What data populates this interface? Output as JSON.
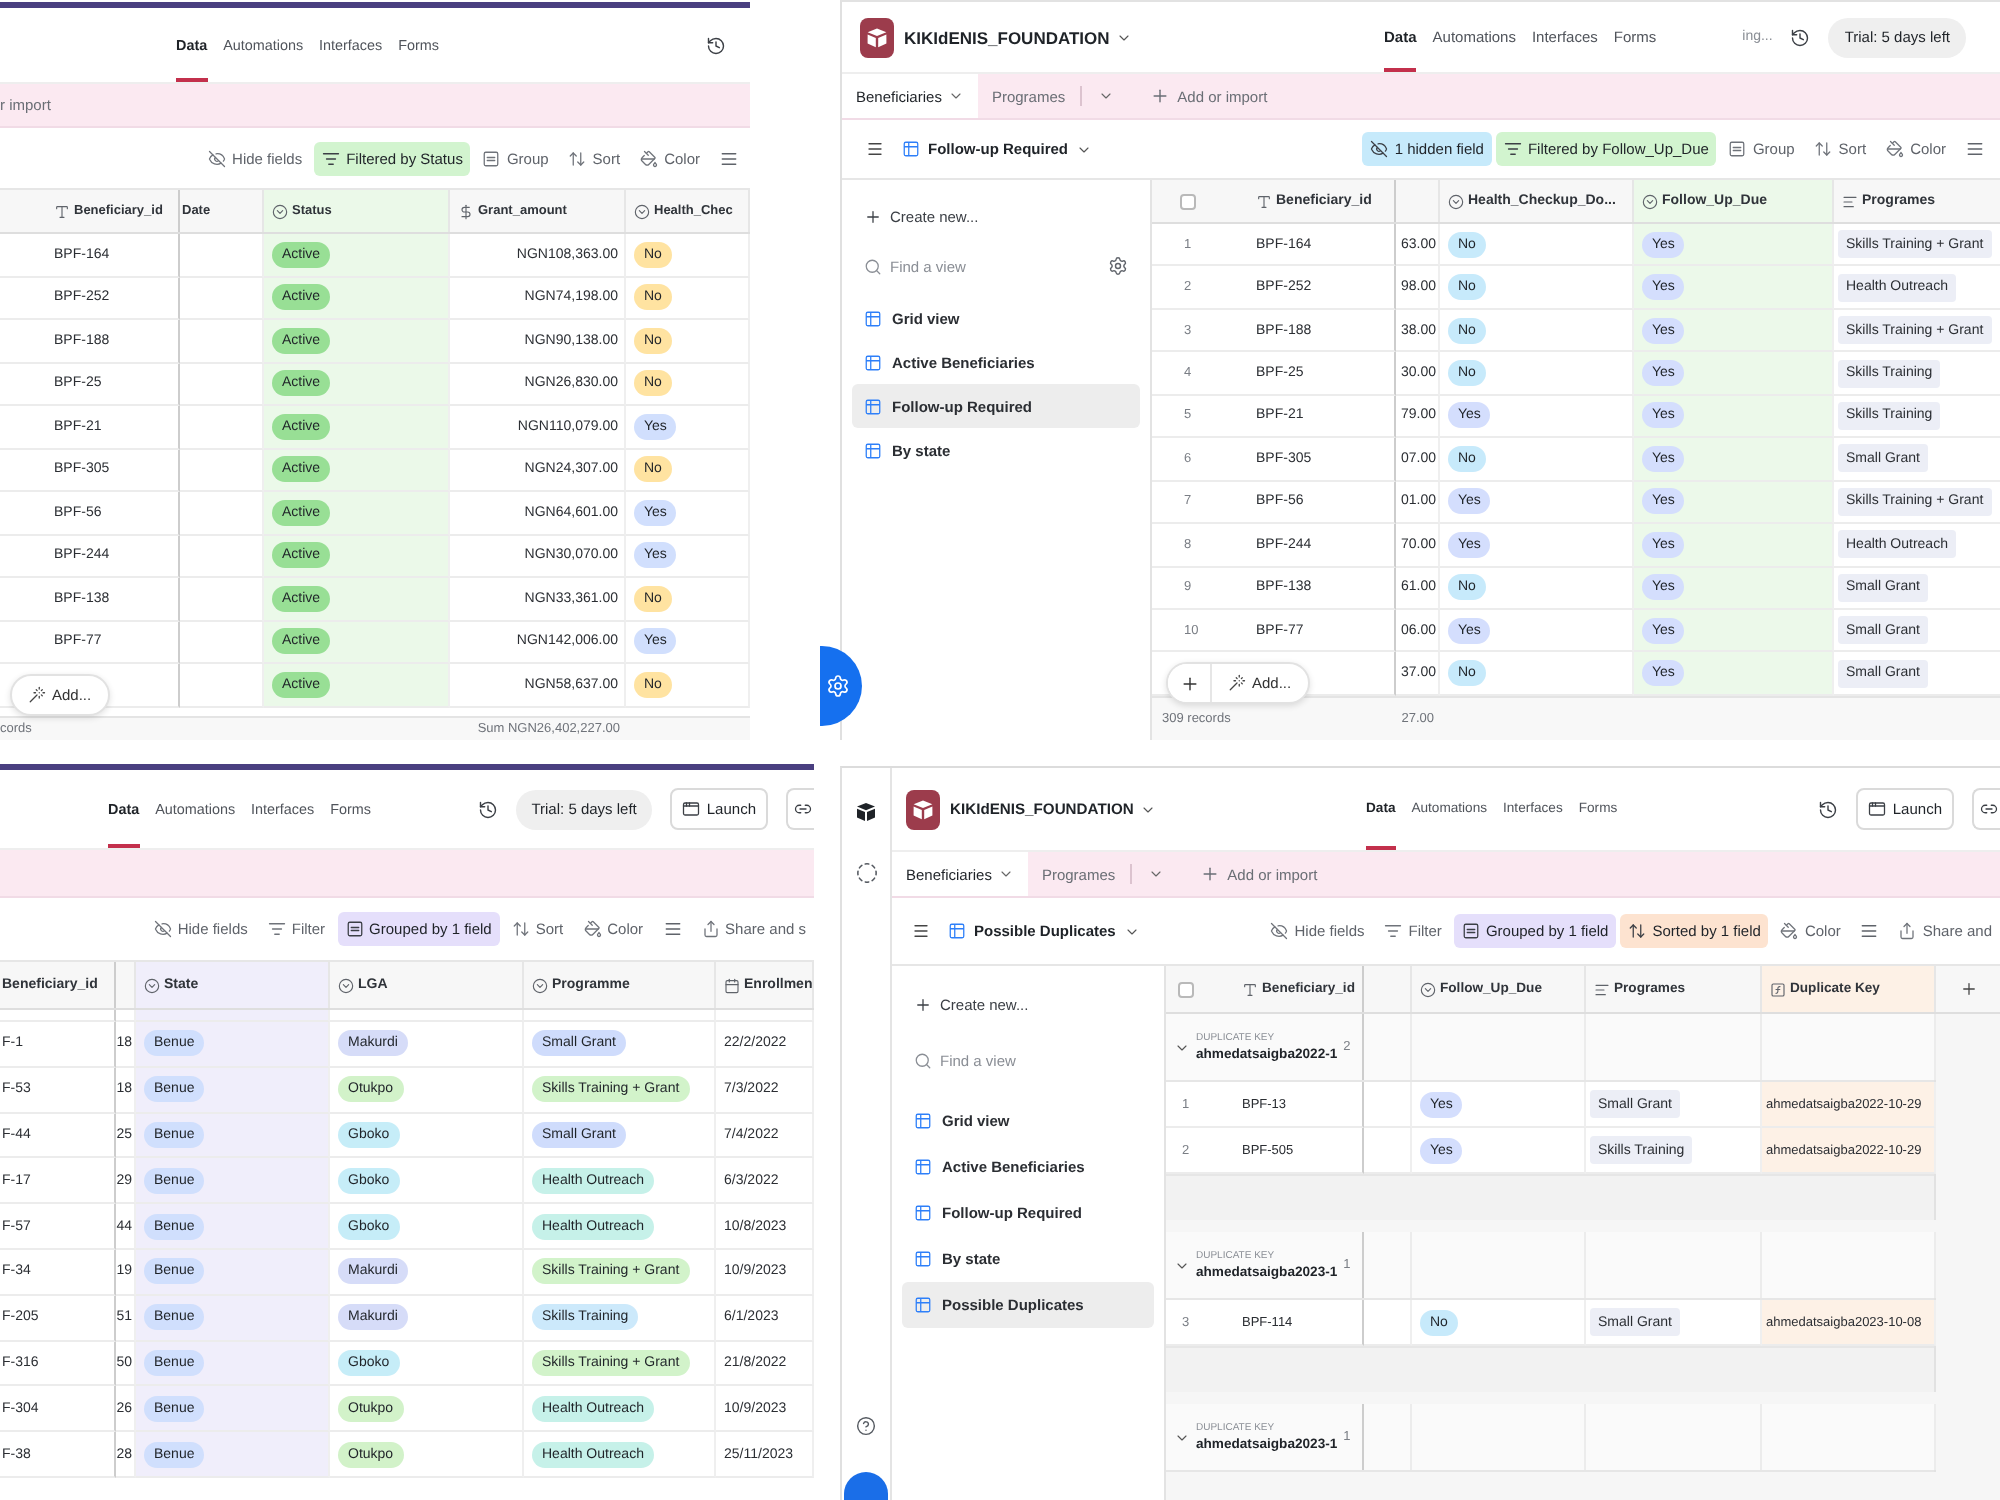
{
  "panels": [
    {
      "header": {
        "nav": [
          {
            "label": "Data",
            "selected": true
          },
          {
            "label": "Automations",
            "selected": false
          },
          {
            "label": "Interfaces",
            "selected": false
          },
          {
            "label": "Forms",
            "selected": false
          }
        ],
        "actions": [
          {
            "kind": "history"
          }
        ]
      },
      "table_tabs": [
        {
          "kind": "text",
          "label": "r import"
        }
      ],
      "toolbar": [
        {
          "kind": "hide",
          "label": "Hide fields"
        },
        {
          "kind": "filter",
          "label": "Filtered by Status",
          "color": "#d2f4cf"
        },
        {
          "kind": "group",
          "label": "Group"
        },
        {
          "kind": "sort",
          "label": "Sort"
        },
        {
          "kind": "color",
          "label": "Color"
        },
        {
          "kind": "row_height"
        }
      ],
      "grid": {
        "columns": [
          {
            "label": "Beneficiary_id",
            "kind": "text"
          },
          {
            "label": "Date",
            "kind": "partial"
          },
          {
            "label": "Status",
            "kind": "pill",
            "color": "#ebf9e9"
          },
          {
            "label": "Grant_amount",
            "kind": "amount"
          },
          {
            "label": "Health_Chec",
            "kind": "pill"
          }
        ],
        "rows": [
          {
            "cells": [
              "BPF-164",
              null,
              {
                "text": "Active",
                "color": "#98df95"
              },
              "NGN108,363.00",
              {
                "text": "No",
                "color": "#ffe3a1"
              }
            ]
          },
          {
            "cells": [
              "BPF-252",
              null,
              {
                "text": "Active",
                "color": "#98df95"
              },
              "NGN74,198.00",
              {
                "text": "No",
                "color": "#ffe3a1"
              }
            ]
          },
          {
            "cells": [
              "BPF-188",
              null,
              {
                "text": "Active",
                "color": "#98df95"
              },
              "NGN90,138.00",
              {
                "text": "No",
                "color": "#ffe3a1"
              }
            ]
          },
          {
            "cells": [
              "BPF-25",
              null,
              {
                "text": "Active",
                "color": "#98df95"
              },
              "NGN26,830.00",
              {
                "text": "No",
                "color": "#ffe3a1"
              }
            ]
          },
          {
            "cells": [
              "BPF-21",
              null,
              {
                "text": "Active",
                "color": "#98df95"
              },
              "NGN110,079.00",
              {
                "text": "Yes",
                "color": "#d1dffd"
              }
            ]
          },
          {
            "cells": [
              "BPF-305",
              null,
              {
                "text": "Active",
                "color": "#98df95"
              },
              "NGN24,307.00",
              {
                "text": "No",
                "color": "#ffe3a1"
              }
            ]
          },
          {
            "cells": [
              "BPF-56",
              null,
              {
                "text": "Active",
                "color": "#98df95"
              },
              "NGN64,601.00",
              {
                "text": "Yes",
                "color": "#d1dffd"
              }
            ]
          },
          {
            "cells": [
              "BPF-244",
              null,
              {
                "text": "Active",
                "color": "#98df95"
              },
              "NGN30,070.00",
              {
                "text": "Yes",
                "color": "#d1dffd"
              }
            ]
          },
          {
            "cells": [
              "BPF-138",
              null,
              {
                "text": "Active",
                "color": "#98df95"
              },
              "NGN33,361.00",
              {
                "text": "No",
                "color": "#ffe3a1"
              }
            ]
          },
          {
            "cells": [
              "BPF-77",
              null,
              {
                "text": "Active",
                "color": "#98df95"
              },
              "NGN142,006.00",
              {
                "text": "Yes",
                "color": "#d1dffd"
              }
            ]
          },
          {
            "cells": [
              null,
              null,
              {
                "text": "Active",
                "color": "#98df95"
              },
              "NGN58,637.00",
              {
                "text": "No",
                "color": "#ffe3a1"
              }
            ]
          }
        ],
        "footer": {
          "records": "cords",
          "summary": "Sum NGN26,402,227.00"
        },
        "add_bar": {
          "label": "Add..."
        }
      }
    },
    {
      "base": {
        "name": "KIKIdENIS_FOUNDATION"
      },
      "header": {
        "nav": [
          {
            "label": "Data",
            "selected": true
          },
          {
            "label": "Automations",
            "selected": false
          },
          {
            "label": "Interfaces",
            "selected": false
          },
          {
            "label": "Forms",
            "selected": false
          }
        ],
        "actions": [
          {
            "kind": "status",
            "label": "ing..."
          },
          {
            "kind": "history"
          },
          {
            "kind": "trial",
            "label": "Trial: 5 days left"
          }
        ]
      },
      "table_tabs": [
        {
          "kind": "table",
          "label": "Beneficiaries",
          "selected": true
        },
        {
          "kind": "table",
          "label": "Programes",
          "selected": false
        },
        {
          "kind": "menu"
        },
        {
          "kind": "add",
          "label": "Add or import"
        }
      ],
      "view": {
        "name": "Follow-up Required"
      },
      "toolbar": [
        {
          "kind": "hide",
          "label": "1 hidden field",
          "color": "#c6eafb"
        },
        {
          "kind": "filter",
          "label": "Filtered by Follow_Up_Due",
          "color": "#d2f4cf"
        },
        {
          "kind": "group",
          "label": "Group"
        },
        {
          "kind": "sort",
          "label": "Sort"
        },
        {
          "kind": "color",
          "label": "Color"
        },
        {
          "kind": "row_height"
        }
      ],
      "sidebar": {
        "create": "Create new...",
        "search_placeholder": "Find a view",
        "settings": true,
        "views": [
          {
            "name": "Grid view",
            "selected": false
          },
          {
            "name": "Active Beneficiaries",
            "selected": false
          },
          {
            "name": "Follow-up Required",
            "selected": true
          },
          {
            "name": "By state",
            "selected": false
          }
        ]
      },
      "grid": {
        "select_all": {
          "checked": false
        },
        "columns": [
          {
            "label": "Beneficiary_id",
            "kind": "text"
          },
          {
            "kind": "partial"
          },
          {
            "label": "Health_Checkup_Do...",
            "kind": "pill"
          },
          {
            "label": "Follow_Up_Due",
            "kind": "pill",
            "color": "#ecf9ea"
          },
          {
            "label": "Programes",
            "kind": "tag"
          }
        ],
        "rows": [
          {
            "number": "1",
            "cells": [
              "BPF-164",
              "63.00",
              {
                "text": "No",
                "color": "#c7eafb"
              },
              {
                "text": "Yes",
                "color": "#d4defd"
              },
              "Skills Training + Grant"
            ]
          },
          {
            "number": "2",
            "cells": [
              "BPF-252",
              "98.00",
              {
                "text": "No",
                "color": "#c7eafb"
              },
              {
                "text": "Yes",
                "color": "#d4defd"
              },
              "Health Outreach"
            ]
          },
          {
            "number": "3",
            "cells": [
              "BPF-188",
              "38.00",
              {
                "text": "No",
                "color": "#c7eafb"
              },
              {
                "text": "Yes",
                "color": "#d4defd"
              },
              "Skills Training + Grant"
            ]
          },
          {
            "number": "4",
            "cells": [
              "BPF-25",
              "30.00",
              {
                "text": "No",
                "color": "#c7eafb"
              },
              {
                "text": "Yes",
                "color": "#d4defd"
              },
              "Skills Training"
            ]
          },
          {
            "number": "5",
            "cells": [
              "BPF-21",
              "79.00",
              {
                "text": "Yes",
                "color": "#d4defd"
              },
              {
                "text": "Yes",
                "color": "#d4defd"
              },
              "Skills Training"
            ]
          },
          {
            "number": "6",
            "cells": [
              "BPF-305",
              "07.00",
              {
                "text": "No",
                "color": "#c7eafb"
              },
              {
                "text": "Yes",
                "color": "#d4defd"
              },
              "Small Grant"
            ]
          },
          {
            "number": "7",
            "cells": [
              "BPF-56",
              "01.00",
              {
                "text": "Yes",
                "color": "#d4defd"
              },
              {
                "text": "Yes",
                "color": "#d4defd"
              },
              "Skills Training + Grant"
            ]
          },
          {
            "number": "8",
            "cells": [
              "BPF-244",
              "70.00",
              {
                "text": "Yes",
                "color": "#d4defd"
              },
              {
                "text": "Yes",
                "color": "#d4defd"
              },
              "Health Outreach"
            ]
          },
          {
            "number": "9",
            "cells": [
              "BPF-138",
              "61.00",
              {
                "text": "No",
                "color": "#c7eafb"
              },
              {
                "text": "Yes",
                "color": "#d4defd"
              },
              "Small Grant"
            ]
          },
          {
            "number": "10",
            "cells": [
              "BPF-77",
              "06.00",
              {
                "text": "Yes",
                "color": "#d4defd"
              },
              {
                "text": "Yes",
                "color": "#d4defd"
              },
              "Small Grant"
            ]
          },
          {
            "cells": [
              null,
              "37.00",
              {
                "text": "No",
                "color": "#c7eafb"
              },
              {
                "text": "Yes",
                "color": "#d4defd"
              },
              "Small Grant"
            ]
          }
        ],
        "footer": {
          "records": "309 records",
          "summary": "27.00"
        },
        "add_bar": {
          "plus": true,
          "label": "Add..."
        }
      }
    },
    {
      "header": {
        "nav": [
          {
            "label": "Data",
            "selected": true
          },
          {
            "label": "Automations",
            "selected": false
          },
          {
            "label": "Interfaces",
            "selected": false
          },
          {
            "label": "Forms",
            "selected": false
          }
        ],
        "actions": [
          {
            "kind": "history"
          },
          {
            "kind": "trial",
            "label": "Trial: 5 days left"
          },
          {
            "kind": "launch",
            "label": "Launch"
          },
          {
            "kind": "link"
          }
        ]
      },
      "toolbar": [
        {
          "kind": "hide",
          "label": "Hide fields"
        },
        {
          "kind": "filter",
          "label": "Filter"
        },
        {
          "kind": "group",
          "label": "Grouped by 1 field",
          "color": "#e5dffb"
        },
        {
          "kind": "sort",
          "label": "Sort"
        },
        {
          "kind": "color",
          "label": "Color"
        },
        {
          "kind": "row_height"
        },
        {
          "kind": "share",
          "label": "Share and s"
        }
      ],
      "grid": {
        "columns": [
          {
            "label": "Beneficiary_id",
            "kind": "text"
          },
          {
            "kind": "partial"
          },
          {
            "label": "State",
            "kind": "pill",
            "color": "#f0eefb"
          },
          {
            "label": "LGA",
            "kind": "pill"
          },
          {
            "label": "Programme",
            "kind": "pill"
          },
          {
            "label": "Enrollmen",
            "kind": "date"
          }
        ],
        "rows": [
          {
            "cells": [
              "F-1",
              "18",
              {
                "text": "Benue",
                "color": "#d0dffd"
              },
              {
                "text": "Makurdi",
                "color": "#d6dcf8"
              },
              {
                "text": "Small Grant",
                "color": "#cfdcfc"
              },
              "22/2/2022"
            ]
          },
          {
            "cells": [
              "F-53",
              "18",
              {
                "text": "Benue",
                "color": "#d0dffd"
              },
              {
                "text": "Otukpo",
                "color": "#d2f2c9"
              },
              {
                "text": "Skills Training + Grant",
                "color": "#d2f3ca"
              },
              "7/3/2022"
            ]
          },
          {
            "cells": [
              "F-44",
              "25",
              {
                "text": "Benue",
                "color": "#d0dffd"
              },
              {
                "text": "Gboko",
                "color": "#c6edf8"
              },
              {
                "text": "Small Grant",
                "color": "#cfdcfc"
              },
              "7/4/2022"
            ]
          },
          {
            "cells": [
              "F-17",
              "29",
              {
                "text": "Benue",
                "color": "#d0dffd"
              },
              {
                "text": "Gboko",
                "color": "#c6edf8"
              },
              {
                "text": "Health Outreach",
                "color": "#c6f1e9"
              },
              "6/3/2022"
            ]
          },
          {
            "cells": [
              "F-57",
              "44",
              {
                "text": "Benue",
                "color": "#d0dffd"
              },
              {
                "text": "Gboko",
                "color": "#c6edf8"
              },
              {
                "text": "Health Outreach",
                "color": "#c6f1e9"
              },
              "10/8/2023"
            ]
          },
          {
            "cells": [
              "F-34",
              "19",
              {
                "text": "Benue",
                "color": "#d0dffd"
              },
              {
                "text": "Makurdi",
                "color": "#d6dcf8"
              },
              {
                "text": "Skills Training + Grant",
                "color": "#d2f3ca"
              },
              "10/9/2023"
            ]
          },
          {
            "cells": [
              "F-205",
              "51",
              {
                "text": "Benue",
                "color": "#d0dffd"
              },
              {
                "text": "Makurdi",
                "color": "#d6dcf8"
              },
              {
                "text": "Skills Training",
                "color": "#cce9fb"
              },
              "6/1/2023"
            ]
          },
          {
            "cells": [
              "F-316",
              "50",
              {
                "text": "Benue",
                "color": "#d0dffd"
              },
              {
                "text": "Gboko",
                "color": "#c6edf8"
              },
              {
                "text": "Skills Training + Grant",
                "color": "#d2f3ca"
              },
              "21/8/2022"
            ]
          },
          {
            "cells": [
              "F-304",
              "26",
              {
                "text": "Benue",
                "color": "#d0dffd"
              },
              {
                "text": "Otukpo",
                "color": "#d2f2c9"
              },
              {
                "text": "Health Outreach",
                "color": "#c6f1e9"
              },
              "10/9/2023"
            ]
          },
          {
            "cells": [
              "F-38",
              "28",
              {
                "text": "Benue",
                "color": "#d0dffd"
              },
              {
                "text": "Otukpo",
                "color": "#d2f2c9"
              },
              {
                "text": "Health Outreach",
                "color": "#c6f1e9"
              },
              "25/11/2023"
            ]
          }
        ]
      }
    },
    {
      "rail": true,
      "base": {
        "name": "KIKIdENIS_FOUNDATION"
      },
      "header": {
        "nav": [
          {
            "label": "Data",
            "selected": true
          },
          {
            "label": "Automations",
            "selected": false
          },
          {
            "label": "Interfaces",
            "selected": false
          },
          {
            "label": "Forms",
            "selected": false
          }
        ],
        "actions": [
          {
            "kind": "history"
          },
          {
            "kind": "launch",
            "label": "Launch"
          },
          {
            "kind": "link"
          }
        ]
      },
      "table_tabs": [
        {
          "kind": "table",
          "label": "Beneficiaries",
          "selected": true
        },
        {
          "kind": "table",
          "label": "Programes",
          "selected": false
        },
        {
          "kind": "menu"
        },
        {
          "kind": "add",
          "label": "Add or import"
        }
      ],
      "view": {
        "name": "Possible Duplicates"
      },
      "toolbar": [
        {
          "kind": "hide",
          "label": "Hide fields"
        },
        {
          "kind": "filter",
          "label": "Filter"
        },
        {
          "kind": "group",
          "label": "Grouped by 1 field",
          "color": "#e5dffb"
        },
        {
          "kind": "sort",
          "label": "Sorted by 1 field",
          "color": "#fde3d0"
        },
        {
          "kind": "color",
          "label": "Color"
        },
        {
          "kind": "row_height"
        },
        {
          "kind": "share",
          "label": "Share and"
        }
      ],
      "sidebar": {
        "create": "Create new...",
        "search_placeholder": "Find a view",
        "views": [
          {
            "name": "Grid view",
            "selected": false
          },
          {
            "name": "Active Beneficiaries",
            "selected": false
          },
          {
            "name": "Follow-up Required",
            "selected": false
          },
          {
            "name": "By state",
            "selected": false
          },
          {
            "name": "Possible Duplicates",
            "selected": true
          }
        ]
      },
      "grid": {
        "select_all": {
          "checked": false
        },
        "add_column": true,
        "columns": [
          {
            "label": "Beneficiary_id",
            "kind": "text"
          },
          {
            "kind": "partial"
          },
          {
            "label": "Follow_Up_Due",
            "kind": "pill"
          },
          {
            "label": "Programes",
            "kind": "tag"
          },
          {
            "label": "Duplicate Key",
            "kind": "formula",
            "color": "#fdf1e6"
          }
        ],
        "groups": [
          {
            "label": "DUPLICATE KEY",
            "value": "ahmedatsaigba2022-1",
            "count": "2",
            "expanded": true,
            "rows": [
              {
                "number": "1",
                "cells": [
                  "BPF-13",
                  null,
                  {
                    "text": "Yes",
                    "color": "#d4defd"
                  },
                  "Small Grant",
                  "ahmedatsaigba2022-10-29"
                ]
              },
              {
                "number": "2",
                "cells": [
                  "BPF-505",
                  null,
                  {
                    "text": "Yes",
                    "color": "#d4defd"
                  },
                  "Skills Training",
                  "ahmedatsaigba2022-10-29"
                ]
              }
            ]
          },
          {
            "label": "DUPLICATE KEY",
            "value": "ahmedatsaigba2023-1",
            "count": "1",
            "expanded": true,
            "rows": [
              {
                "number": "3",
                "cells": [
                  "BPF-114",
                  null,
                  {
                    "text": "No",
                    "color": "#c7eafb"
                  },
                  "Small Grant",
                  "ahmedatsaigba2023-10-08"
                ]
              }
            ]
          },
          {
            "label": "DUPLICATE KEY",
            "value": "ahmedatsaigba2023-1",
            "count": "1",
            "expanded": true
          }
        ]
      }
    }
  ]
}
